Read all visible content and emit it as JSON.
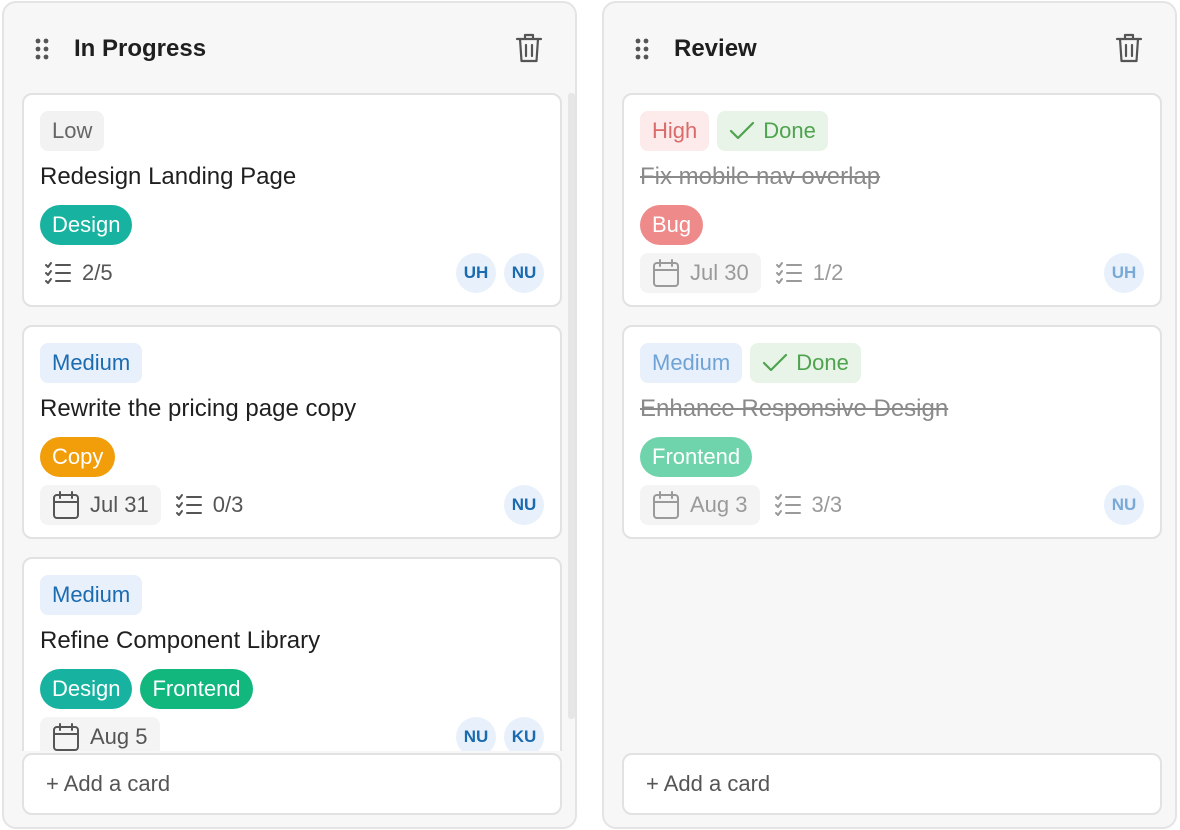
{
  "colors": {
    "design": "#18b3a0",
    "copy": "#f29d0a",
    "frontend": "#12b77e",
    "bug": "#ee8a8a",
    "frontend_muted": "#6fd4ab"
  },
  "columns": [
    {
      "title": "In Progress",
      "add_card_label": "+ Add a card",
      "cards": [
        {
          "priority": "Low",
          "title": "Redesign Landing Page",
          "tags": [
            "Design"
          ],
          "checklist": "2/5",
          "avatars": [
            "UH",
            "NU"
          ]
        },
        {
          "priority": "Medium",
          "title": "Rewrite the pricing page copy",
          "tags": [
            "Copy"
          ],
          "due": "Jul 31",
          "checklist": "0/3",
          "avatars": [
            "NU"
          ]
        },
        {
          "priority": "Medium",
          "title": "Refine Component Library",
          "tags": [
            "Design",
            "Frontend"
          ],
          "due": "Aug 5",
          "avatars": [
            "NU",
            "KU"
          ]
        }
      ]
    },
    {
      "title": "Review",
      "add_card_label": "+ Add a card",
      "cards": [
        {
          "priority": "High",
          "status": "Done",
          "title": "Fix mobile nav overlap",
          "tags": [
            "Bug"
          ],
          "due": "Jul 30",
          "checklist": "1/2",
          "avatars": [
            "UH"
          ]
        },
        {
          "priority": "Medium",
          "status": "Done",
          "title": "Enhance Responsive Design",
          "tags": [
            "Frontend"
          ],
          "due": "Aug 3",
          "checklist": "3/3",
          "avatars": [
            "NU"
          ]
        }
      ]
    }
  ]
}
